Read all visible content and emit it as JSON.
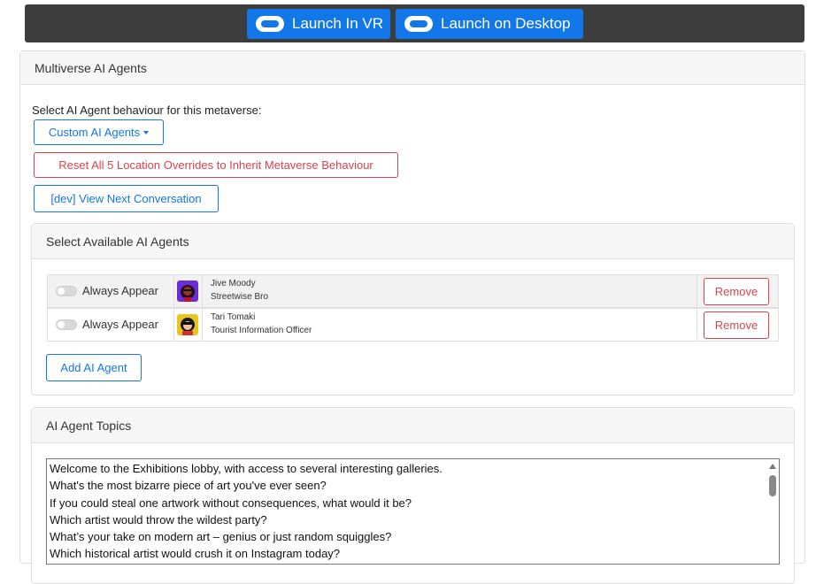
{
  "topbar": {
    "launch_vr_label": "Launch In VR",
    "launch_desktop_label": "Launch on Desktop",
    "accent": "#1277e8"
  },
  "main_card": {
    "header": "Multiverse AI Agents",
    "behaviour_prompt": "Select AI Agent behaviour for this metaverse:",
    "behaviour_dropdown_value": "Custom AI Agents",
    "reset_button": "Reset All 5 Location Overrides to Inherit Metaverse Behaviour",
    "view_conversation_button": "[dev] View Next Conversation"
  },
  "agents_card": {
    "header": "Select Available AI Agents",
    "agents": [
      {
        "toggle_label": "Always Appear",
        "name": "Jive Moody",
        "role": "Streetwise Bro",
        "remove_label": "Remove",
        "avatar_icon": "jive-moody-avatar"
      },
      {
        "toggle_label": "Always Appear",
        "name": "Tari Tomaki",
        "role": "Tourist Information Officer",
        "remove_label": "Remove",
        "avatar_icon": "tari-tomaki-avatar"
      }
    ],
    "add_button": "Add AI Agent"
  },
  "topics_card": {
    "header": "AI Agent Topics",
    "lines": [
      "Welcome to the Exhibitions lobby, with access to several interesting galleries.",
      "What's the most bizarre piece of art you've ever seen?",
      "If you could steal one artwork without consequences, what would it be?",
      "Which artist would throw the wildest party?",
      "What’s your take on modern art – genius or just random squiggles?",
      "Which historical artist would crush it on Instagram today?"
    ]
  }
}
